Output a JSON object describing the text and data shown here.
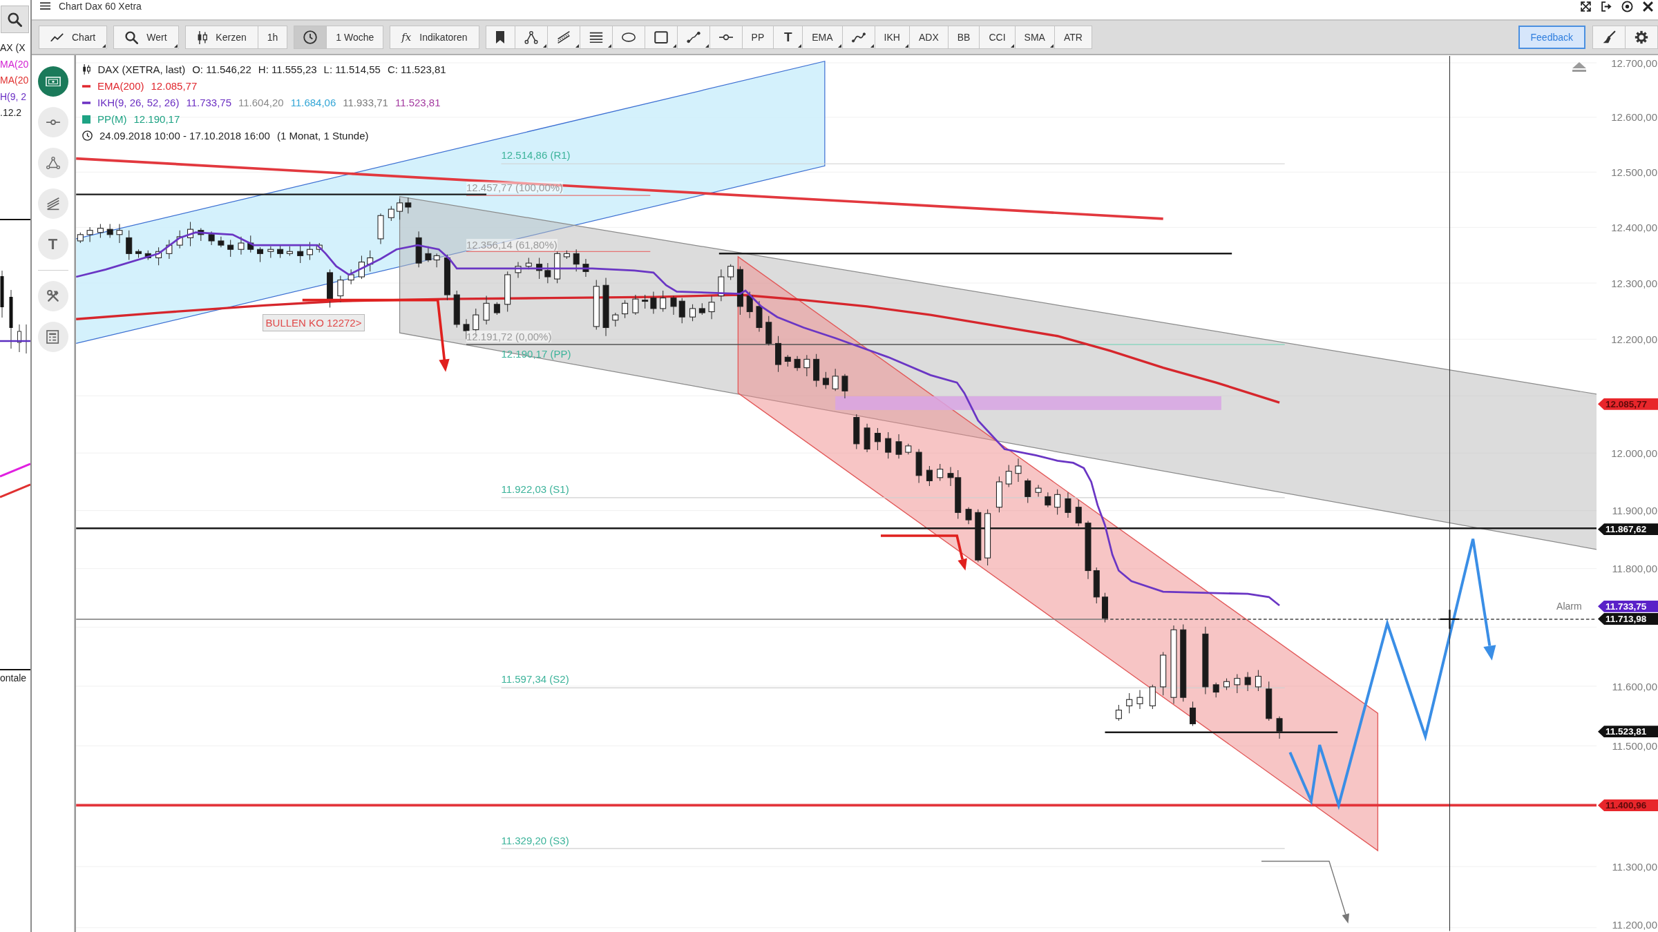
{
  "side_window": {
    "legend": [
      {
        "text": "AX (X",
        "color": "#222222"
      },
      {
        "text": "MA(20",
        "color": "#d21fd2"
      },
      {
        "text": "MA(20",
        "color": "#e0302f"
      },
      {
        "text": "H(9, 2",
        "color": "#6a2fc4"
      },
      {
        "text": ".12.2",
        "color": "#222222"
      }
    ],
    "axis_label": "ontale"
  },
  "window": {
    "title": "Chart Dax 60 Xetra"
  },
  "toolbar": {
    "groups": [
      {
        "items": [
          {
            "kind": "icon_text",
            "label": "Chart",
            "has_menu": true,
            "pressed": false
          }
        ]
      },
      {
        "items": [
          {
            "kind": "icon_text",
            "label": "Wert",
            "has_menu": true,
            "pressed": false
          }
        ]
      },
      {
        "items": [
          {
            "kind": "icon_text",
            "label": "Kerzen",
            "has_menu": false,
            "pressed": false
          },
          {
            "kind": "text",
            "label": "1h",
            "has_menu": false,
            "pressed": false
          }
        ]
      },
      {
        "items": [
          {
            "kind": "icon",
            "has_menu": false,
            "pressed": true
          },
          {
            "kind": "text",
            "label": "1 Woche",
            "has_menu": false,
            "pressed": false
          }
        ]
      },
      {
        "items": [
          {
            "kind": "prefix_text",
            "prefix": "fx",
            "label": "Indikatoren",
            "has_menu": false,
            "pressed": false
          }
        ]
      },
      {
        "items": [
          {
            "kind": "icon",
            "has_menu": false,
            "pressed": false
          },
          {
            "kind": "icon",
            "has_menu": true,
            "pressed": false
          },
          {
            "kind": "icon",
            "has_menu": true,
            "pressed": false
          },
          {
            "kind": "icon",
            "has_menu": true,
            "pressed": false
          },
          {
            "kind": "icon",
            "has_menu": false,
            "pressed": false
          },
          {
            "kind": "icon",
            "has_menu": true,
            "pressed": false
          },
          {
            "kind": "icon",
            "has_menu": true,
            "pressed": false
          },
          {
            "kind": "icon",
            "has_menu": false,
            "pressed": false
          },
          {
            "kind": "text",
            "label": "PP",
            "has_menu": false,
            "pressed": false
          },
          {
            "kind": "glyph",
            "label": "T",
            "has_menu": true,
            "pressed": false
          },
          {
            "kind": "text",
            "label": "EMA",
            "has_menu": true,
            "pressed": false
          },
          {
            "kind": "icon",
            "has_menu": true,
            "pressed": false
          },
          {
            "kind": "text",
            "label": "IKH",
            "has_menu": true,
            "pressed": false
          },
          {
            "kind": "text",
            "label": "ADX",
            "has_menu": false,
            "pressed": false
          },
          {
            "kind": "text",
            "label": "BB",
            "has_menu": false,
            "pressed": false
          },
          {
            "kind": "text",
            "label": "CCI",
            "has_menu": true,
            "pressed": false
          },
          {
            "kind": "text",
            "label": "SMA",
            "has_menu": true,
            "pressed": false
          },
          {
            "kind": "text",
            "label": "ATR",
            "has_menu": false,
            "pressed": false
          }
        ]
      }
    ],
    "right": [
      {
        "kind": "text",
        "label": "Feedback",
        "has_menu": false,
        "pressed": false
      },
      {
        "kind": "icon",
        "has_menu": false,
        "pressed": false
      },
      {
        "kind": "icon",
        "has_menu": false,
        "pressed": false
      }
    ]
  },
  "tool_sidebar": {
    "groups": [
      {
        "items": [
          {
            "kind": "icon",
            "selected": true
          },
          {
            "kind": "icon",
            "selected": false
          },
          {
            "kind": "icon",
            "selected": false
          },
          {
            "kind": "icon",
            "selected": false
          },
          {
            "kind": "glyph",
            "label": "T",
            "selected": false
          }
        ]
      },
      {
        "items": [
          {
            "kind": "icon",
            "selected": false
          },
          {
            "kind": "icon",
            "selected": false
          }
        ]
      }
    ]
  },
  "chart": {
    "legend": {
      "instrument": "DAX (XETRA, last)",
      "ohlc": [
        "O: 11.546,22",
        "H: 11.555,23",
        "L: 11.514,55",
        "C: 11.523,81"
      ],
      "indicators": [
        {
          "kind": "line",
          "name": "EMA(200)",
          "color": "#e0262d",
          "values": [
            {
              "text": "12.085,77",
              "color": "#e0262d"
            }
          ]
        },
        {
          "kind": "line",
          "name": "IKH(9, 26, 52, 26)",
          "color": "#6b2fc2",
          "values": [
            {
              "text": "11.733,75",
              "color": "#6b2fc2"
            },
            {
              "text": "11.604,20",
              "color": "#8a8a8a"
            },
            {
              "text": "11.684,06",
              "color": "#33a6d6"
            },
            {
              "text": "11.933,71",
              "color": "#7a7a7a"
            },
            {
              "text": "11.523,81",
              "color": "#a3399f"
            }
          ]
        },
        {
          "kind": "area",
          "name": "PP(M)",
          "color": "#1ea384",
          "values": [
            {
              "text": "12.190,17",
              "color": "#1ea384"
            }
          ]
        }
      ],
      "period": "24.09.2018 10:00 - 17.10.2018 16:00",
      "resolution": "(1 Monat, 1 Stunde)"
    },
    "annotations": [
      {
        "kind": "pivot",
        "text": "12.514,86 (R1)"
      },
      {
        "kind": "fib",
        "text": "12.457,77 (100,00%)"
      },
      {
        "kind": "fib",
        "text": "12.356,14 (61,80%)"
      },
      {
        "kind": "fib",
        "text": "12.191,72 (0,00%)"
      },
      {
        "kind": "pivot",
        "text": "12.190,17 (PP)"
      },
      {
        "kind": "pivot",
        "text": "11.922,03 (S1)"
      },
      {
        "kind": "pivot",
        "text": "11.597,34 (S2)"
      },
      {
        "kind": "pivot",
        "text": "11.329,20 (S3)"
      }
    ],
    "ko_label": "BULLEN KO 12272>",
    "alarm_label": "Alarm",
    "y_axis_labels": [
      "12.700,00",
      "12.600,00",
      "12.500,00",
      "12.400,00",
      "12.300,00",
      "12.200,00",
      "12.000,00",
      "11.900,00",
      "11.800,00",
      "11.600,00",
      "11.500,00",
      "11.300,00",
      "11.200,00"
    ],
    "price_tags": [
      {
        "text": "12.085,77",
        "color": "#e8262b"
      },
      {
        "text": "11.867,62",
        "color": "#111111"
      },
      {
        "text": "11.733,75",
        "color": "#5a22c8"
      },
      {
        "text": "11.713,98",
        "color": "#111111"
      },
      {
        "text": "11.523,81",
        "color": "#111111"
      },
      {
        "text": "11.400,96",
        "color": "#e8262b"
      }
    ]
  }
}
